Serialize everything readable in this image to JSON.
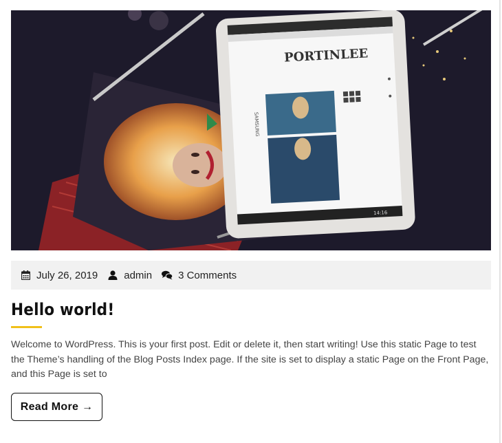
{
  "post": {
    "image_alt": "Tablet displaying a fashion blog on a dark table with a magazine",
    "tablet_brand": "SAMSUNG",
    "tablet_site_logo": "PORTINLEE",
    "tablet_time": "14:16",
    "meta": {
      "date": "July 26, 2019",
      "author": "admin",
      "comments": "3 Comments"
    },
    "title": "Hello world!",
    "excerpt": "Welcome to WordPress. This is your first post. Edit or delete it, then start writing! Use this static Page to test the Theme’s handling of the Blog Posts Index page. If the site is set to display a static Page on the Front Page, and this Page is set to",
    "read_more": "Read More →"
  },
  "colors": {
    "accent": "#f0c019",
    "meta_bg": "#f1f1f1",
    "title": "#111111"
  },
  "icons": [
    "calendar-icon",
    "user-icon",
    "comments-icon"
  ]
}
